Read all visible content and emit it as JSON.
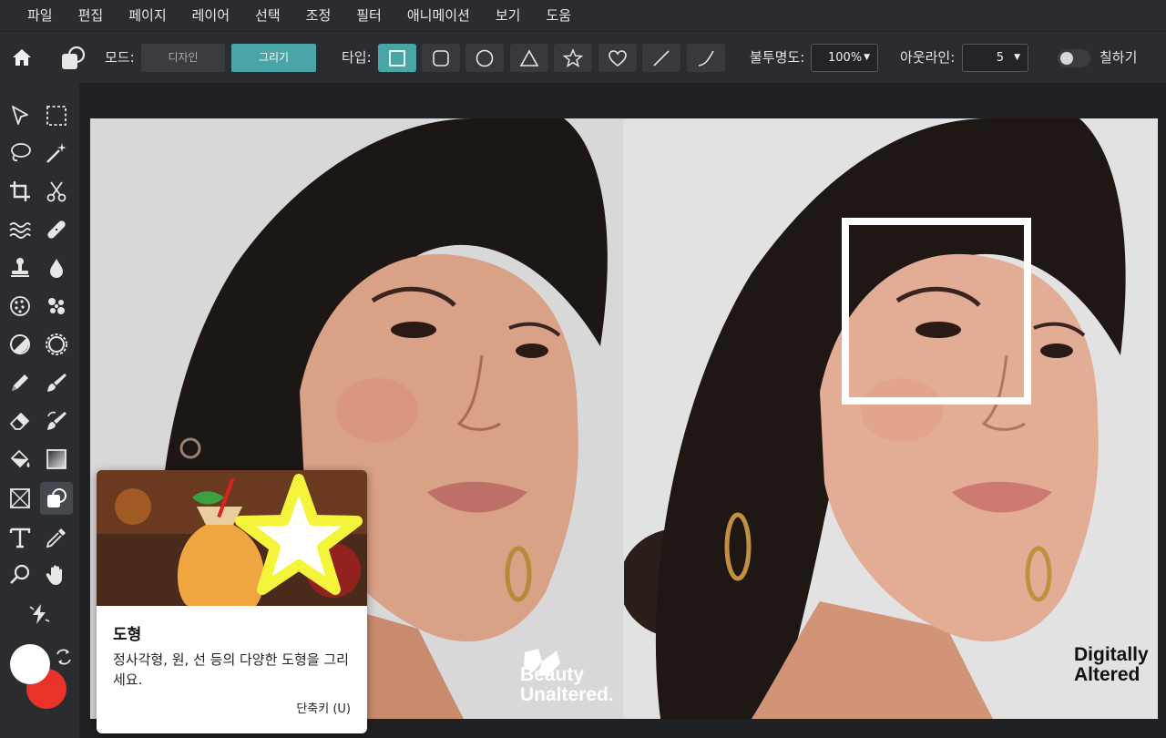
{
  "menu": [
    "파일",
    "편집",
    "페이지",
    "레이어",
    "선택",
    "조정",
    "필터",
    "애니메이션",
    "보기",
    "도움"
  ],
  "toolbar": {
    "mode_label": "모드:",
    "mode_design": "디자인",
    "mode_draw": "그리기",
    "type_label": "타입:",
    "shape_types": [
      "rectangle",
      "rounded-rectangle",
      "circle",
      "triangle",
      "star",
      "heart",
      "line",
      "curve"
    ],
    "active_shape": "rectangle",
    "opacity_label": "불투명도:",
    "opacity_value": "100%",
    "outline_label": "아웃라인:",
    "outline_value": "5",
    "fill_label": "칠하기",
    "fill_enabled": false
  },
  "tools": [
    [
      "arrow-select-icon",
      "marquee-select-icon"
    ],
    [
      "lasso-icon",
      "magic-wand-icon"
    ],
    [
      "crop-icon",
      "scissors-icon"
    ],
    [
      "liquify-icon",
      "healing-bandage-icon"
    ],
    [
      "stamp-icon",
      "drop-blur-icon"
    ],
    [
      "sponge-icon",
      "sharpen-icon"
    ],
    [
      "dodge-icon",
      "burn-icon"
    ],
    [
      "pencil-icon",
      "brush-icon"
    ],
    [
      "eraser-icon",
      "color-replace-icon"
    ],
    [
      "paint-bucket-icon",
      "gradient-icon"
    ],
    [
      "frame-icon",
      "shape-tool-icon"
    ],
    [
      "text-icon",
      "eyedropper-icon"
    ],
    [
      "zoom-icon",
      "hand-icon"
    ],
    [
      "quick-action-icon"
    ]
  ],
  "active_tool": "shape-tool-icon",
  "colors": {
    "foreground": "#ffffff",
    "background": "#e8322a",
    "accent": "#4aa6a6"
  },
  "canvas": {
    "left_watermark": "Beauty\nUnaltered.",
    "right_watermark": "Digitally\nAltered"
  },
  "tooltip": {
    "title": "도형",
    "description": "정사각형, 원, 선 등의 다양한 도형을 그리세요.",
    "shortcut": "단축키 (U)"
  }
}
